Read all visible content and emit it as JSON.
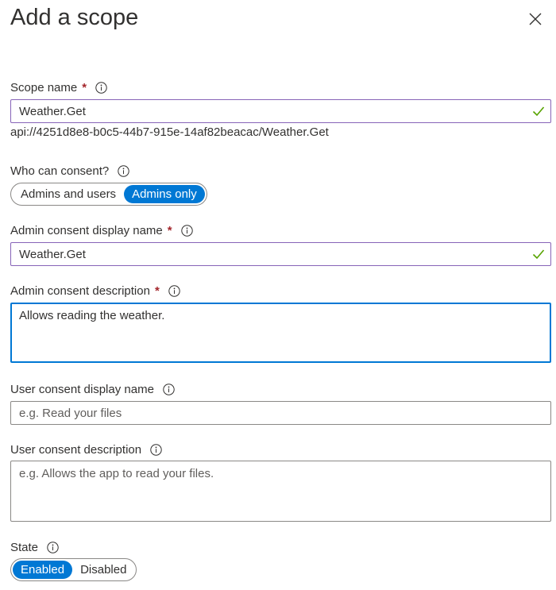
{
  "header": {
    "title": "Add a scope",
    "close_icon": "close-icon"
  },
  "scope_name": {
    "label": "Scope name",
    "required_marker": "*",
    "value": "Weather.Get",
    "uri": "api://4251d8e8-b0c5-44b7-915e-14af82beacac/Weather.Get"
  },
  "who_can_consent": {
    "label": "Who can consent?",
    "options": [
      "Admins and users",
      "Admins only"
    ],
    "selected": "Admins only"
  },
  "admin_display_name": {
    "label": "Admin consent display name",
    "required_marker": "*",
    "value": "Weather.Get"
  },
  "admin_description": {
    "label": "Admin consent description",
    "required_marker": "*",
    "value": "Allows reading the weather."
  },
  "user_display_name": {
    "label": "User consent display name",
    "value": "",
    "placeholder": "e.g. Read your files"
  },
  "user_description": {
    "label": "User consent description",
    "value": "",
    "placeholder": "e.g. Allows the app to read your files."
  },
  "state": {
    "label": "State",
    "options": [
      "Enabled",
      "Disabled"
    ],
    "selected": "Enabled"
  },
  "colors": {
    "accent": "#0078d4",
    "required": "#a4262c",
    "valid_check": "#57a300",
    "valid_border": "#8764b8"
  }
}
